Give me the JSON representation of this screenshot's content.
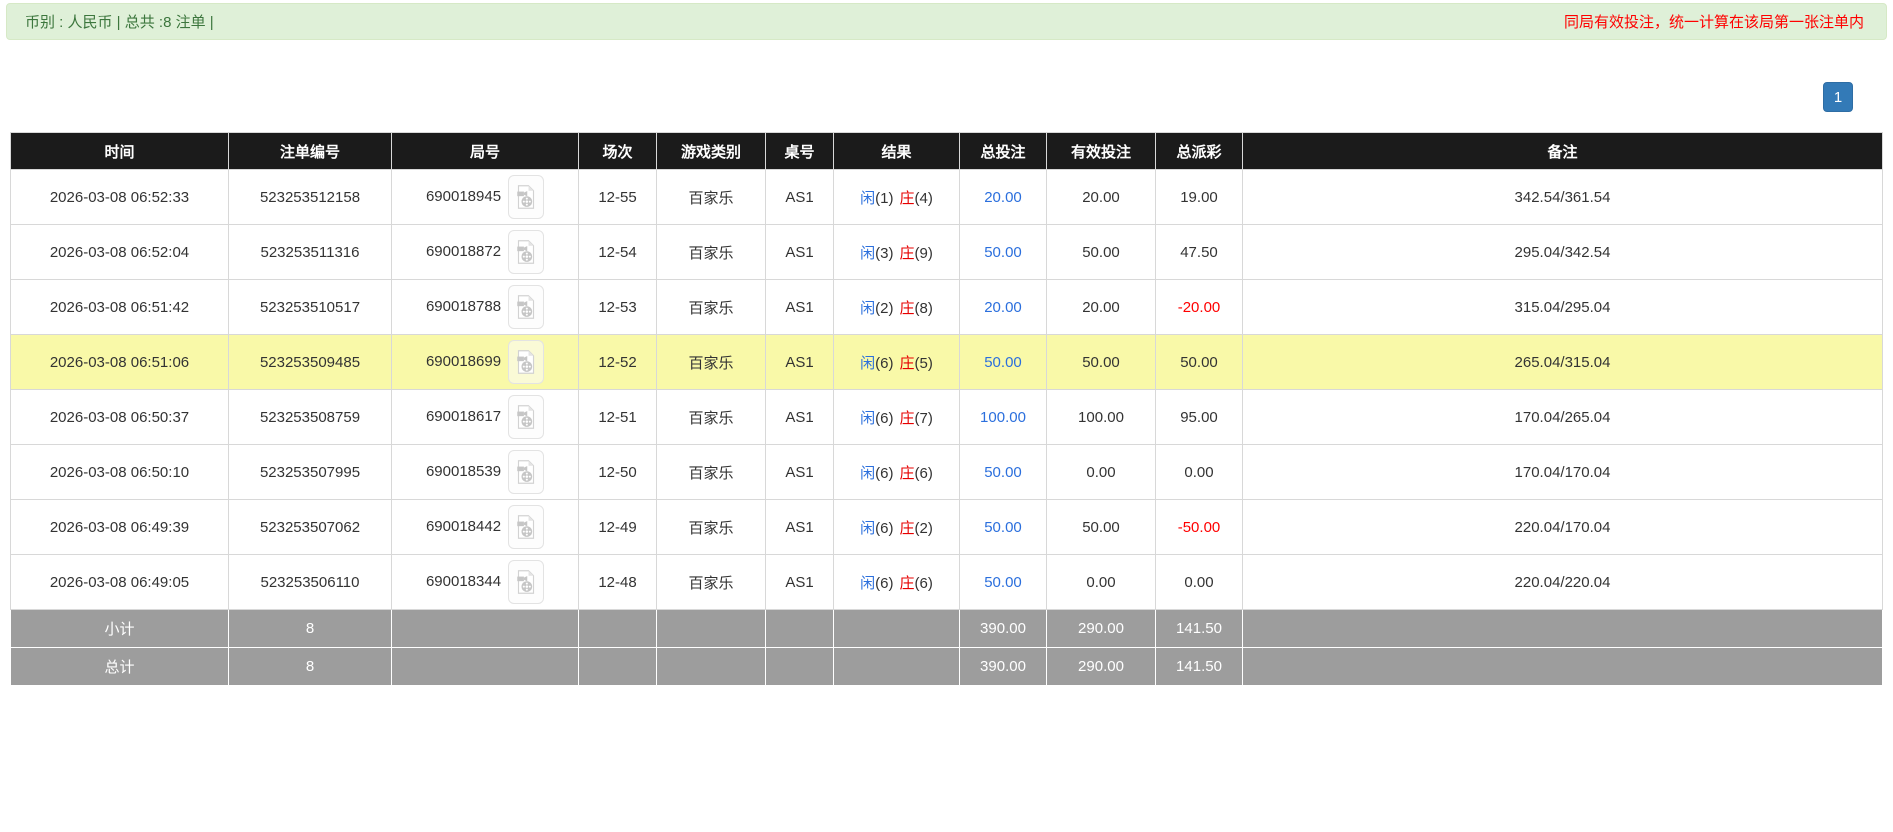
{
  "top_bar": {
    "summary": "币别 : 人民币 | 总共 :8 注单 |",
    "notice": "同局有效投注，统一计算在该局第一张注单内"
  },
  "pagination": {
    "current_page": "1"
  },
  "colors": {
    "alert_bg": "#dff0d8",
    "notice_red": "#ff0000",
    "header_bg": "#1b1b1b",
    "footer_bg": "#9d9d9d",
    "highlight_yellow": "#f9f9a8",
    "link_blue": "#2b6fdd",
    "player_blue": "#2b6fdd",
    "banker_red": "#e60000",
    "negative_red": "#ff0000",
    "page_btn_blue": "#337ab7"
  },
  "icons": {
    "round_video_icon": "video-file-icon"
  },
  "table": {
    "headers": [
      "时间",
      "注单编号",
      "局号",
      "场次",
      "游戏类别",
      "桌号",
      "结果",
      "总投注",
      "有效投注",
      "总派彩",
      "备注"
    ],
    "rows": [
      {
        "time": "2026-03-08 06:52:33",
        "bet_id": "523253512158",
        "round_id": "690018945",
        "session": "12-55",
        "game_type": "百家乐",
        "table_no": "AS1",
        "result": {
          "player": "闲",
          "player_n": "(1)",
          "banker": "庄",
          "banker_n": "(4)"
        },
        "total_bet": "20.00",
        "valid_bet": "20.00",
        "payout": "19.00",
        "remark": "342.54/361.54"
      },
      {
        "time": "2026-03-08 06:52:04",
        "bet_id": "523253511316",
        "round_id": "690018872",
        "session": "12-54",
        "game_type": "百家乐",
        "table_no": "AS1",
        "result": {
          "player": "闲",
          "player_n": "(3)",
          "banker": "庄",
          "banker_n": "(9)"
        },
        "total_bet": "50.00",
        "valid_bet": "50.00",
        "payout": "47.50",
        "remark": "295.04/342.54"
      },
      {
        "time": "2026-03-08 06:51:42",
        "bet_id": "523253510517",
        "round_id": "690018788",
        "session": "12-53",
        "game_type": "百家乐",
        "table_no": "AS1",
        "result": {
          "player": "闲",
          "player_n": "(2)",
          "banker": "庄",
          "banker_n": "(8)"
        },
        "total_bet": "20.00",
        "valid_bet": "20.00",
        "payout": "-20.00",
        "remark": "315.04/295.04"
      },
      {
        "time": "2026-03-08 06:51:06",
        "bet_id": "523253509485",
        "round_id": "690018699",
        "session": "12-52",
        "game_type": "百家乐",
        "table_no": "AS1",
        "result": {
          "player": "闲",
          "player_n": "(6)",
          "banker": "庄",
          "banker_n": "(5)"
        },
        "total_bet": "50.00",
        "valid_bet": "50.00",
        "payout": "50.00",
        "remark": "265.04/315.04"
      },
      {
        "time": "2026-03-08 06:50:37",
        "bet_id": "523253508759",
        "round_id": "690018617",
        "session": "12-51",
        "game_type": "百家乐",
        "table_no": "AS1",
        "result": {
          "player": "闲",
          "player_n": "(6)",
          "banker": "庄",
          "banker_n": "(7)"
        },
        "total_bet": "100.00",
        "valid_bet": "100.00",
        "payout": "95.00",
        "remark": "170.04/265.04"
      },
      {
        "time": "2026-03-08 06:50:10",
        "bet_id": "523253507995",
        "round_id": "690018539",
        "session": "12-50",
        "game_type": "百家乐",
        "table_no": "AS1",
        "result": {
          "player": "闲",
          "player_n": "(6)",
          "banker": "庄",
          "banker_n": "(6)"
        },
        "total_bet": "50.00",
        "valid_bet": "0.00",
        "payout": "0.00",
        "remark": "170.04/170.04"
      },
      {
        "time": "2026-03-08 06:49:39",
        "bet_id": "523253507062",
        "round_id": "690018442",
        "session": "12-49",
        "game_type": "百家乐",
        "table_no": "AS1",
        "result": {
          "player": "闲",
          "player_n": "(6)",
          "banker": "庄",
          "banker_n": "(2)"
        },
        "total_bet": "50.00",
        "valid_bet": "50.00",
        "payout": "-50.00",
        "remark": "220.04/170.04"
      },
      {
        "time": "2026-03-08 06:49:05",
        "bet_id": "523253506110",
        "round_id": "690018344",
        "session": "12-48",
        "game_type": "百家乐",
        "table_no": "AS1",
        "result": {
          "player": "闲",
          "player_n": "(6)",
          "banker": "庄",
          "banker_n": "(6)"
        },
        "total_bet": "50.00",
        "valid_bet": "0.00",
        "payout": "0.00",
        "remark": "220.04/220.04"
      }
    ],
    "footer": [
      {
        "label": "小计",
        "count": "8",
        "total_bet": "390.00",
        "valid_bet": "290.00",
        "payout": "141.50"
      },
      {
        "label": "总计",
        "count": "8",
        "total_bet": "390.00",
        "valid_bet": "290.00",
        "payout": "141.50"
      }
    ]
  }
}
